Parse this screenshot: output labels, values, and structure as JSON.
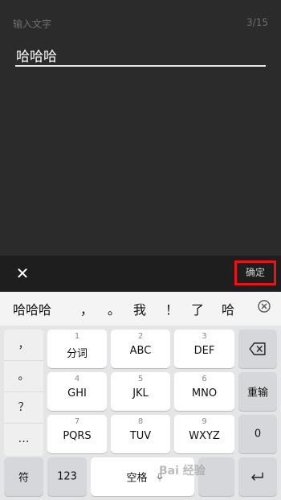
{
  "editor": {
    "hint": "输入文字",
    "counter": "3/15",
    "text": "哈哈哈"
  },
  "actionbar": {
    "close_label": "✕",
    "confirm_label": "确定",
    "confirm_highlight_color": "#e8141a"
  },
  "candidates": {
    "items": [
      "哈哈哈",
      "，",
      "。",
      "我",
      "！",
      "了",
      "哈"
    ],
    "clear_icon": "clear-circle-icon"
  },
  "keyboard": {
    "symbols": [
      "，",
      "。",
      "？",
      "…"
    ],
    "keys": [
      {
        "num": "1",
        "label": "分词"
      },
      {
        "num": "2",
        "label": "ABC"
      },
      {
        "num": "3",
        "label": "DEF"
      },
      {
        "num": "4",
        "label": "GHI"
      },
      {
        "num": "5",
        "label": "JKL"
      },
      {
        "num": "6",
        "label": "MNO"
      },
      {
        "num": "7",
        "label": "PQRS"
      },
      {
        "num": "8",
        "label": "TUV"
      },
      {
        "num": "9",
        "label": "WXYZ"
      }
    ],
    "backspace_icon": "backspace-icon",
    "reinput_label": "重输",
    "zero_label": "0",
    "fu_label": "符",
    "num_label": "123",
    "space_label": "空格",
    "mic_icon": "microphone-icon",
    "enter_icon": "enter-icon"
  },
  "watermark": "Bai 经验"
}
